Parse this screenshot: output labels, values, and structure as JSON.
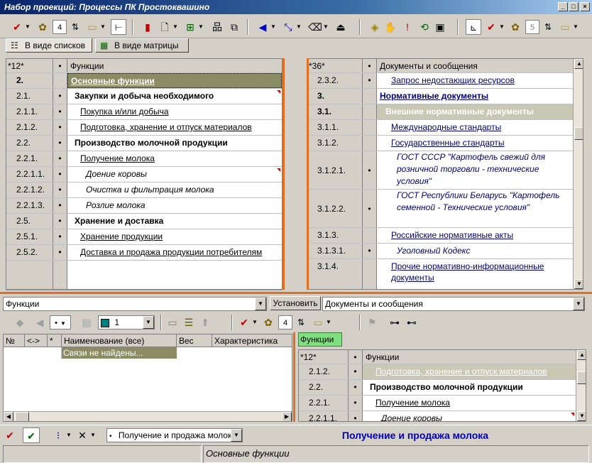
{
  "window": {
    "title": "Набор проекций: Процессы ПК Простоквашино"
  },
  "toolbar": {
    "spin1_value": "4",
    "spin2_value": "5"
  },
  "tabs": [
    {
      "label": "В виде списков"
    },
    {
      "label": "В виде матрицы"
    }
  ],
  "left_grid": {
    "header": {
      "code": "*12*",
      "dot": "•",
      "name": "Функции"
    },
    "rows": [
      {
        "code": "2.",
        "dot": "",
        "name": "Основные функции"
      },
      {
        "code": "2.1.",
        "dot": "•",
        "name": "Закупки и добыча необходимого"
      },
      {
        "code": "2.1.1.",
        "dot": "•",
        "name": "Покупка и/или добыча"
      },
      {
        "code": "2.1.2.",
        "dot": "•",
        "name": "Подготовка, хранение и отпуск материалов"
      },
      {
        "code": "2.2.",
        "dot": "•",
        "name": "Производство молочной продукции"
      },
      {
        "code": "2.2.1.",
        "dot": "•",
        "name": "Получение молока"
      },
      {
        "code": "2.2.1.1.",
        "dot": "•",
        "name": "Доение коровы"
      },
      {
        "code": "2.2.1.2.",
        "dot": "•",
        "name": "Очистка и фильтрация молока"
      },
      {
        "code": "2.2.1.3.",
        "dot": "•",
        "name": "Розлие молока"
      },
      {
        "code": "2.5.",
        "dot": "•",
        "name": "Хранение и доставка"
      },
      {
        "code": "2.5.1.",
        "dot": "•",
        "name": "Хранение продукции"
      },
      {
        "code": "2.5.2.",
        "dot": "•",
        "name": "Доставка и продажа продукции потребителям"
      }
    ]
  },
  "right_grid": {
    "header": {
      "code": "*36*",
      "dot": "•",
      "name": "Документы и сообщения"
    },
    "rows": [
      {
        "code": "2.3.2.",
        "dot": "•",
        "name": "Запрос недостающих ресурсов"
      },
      {
        "code": "3.",
        "dot": "",
        "name": "Нормативные документы"
      },
      {
        "code": "3.1.",
        "dot": "",
        "name": "Внешние нормативные документы"
      },
      {
        "code": "3.1.1.",
        "dot": "",
        "name": "Международные стандарты"
      },
      {
        "code": "3.1.2.",
        "dot": "",
        "name": "Государственные стандарты"
      },
      {
        "code": "3.1.2.1.",
        "dot": "•",
        "name": "ГОСТ СССР \"Картофель свежий для розничной торговли - технические условия\""
      },
      {
        "code": "3.1.2.2.",
        "dot": "•",
        "name": "ГОСТ Республики Беларусь \"Картофель семенной - Технические условия\""
      },
      {
        "code": "3.1.3.",
        "dot": "",
        "name": "Российские нормативные акты"
      },
      {
        "code": "3.1.3.1.",
        "dot": "•",
        "name": "Уголовный Кодекс"
      },
      {
        "code": "3.1.4.",
        "dot": "",
        "name": "Прочие нормативно-информационные документы"
      }
    ]
  },
  "middle": {
    "left_combo": "Функции",
    "set_button": "Установить",
    "right_combo": "Документы и сообщения"
  },
  "bottom_toolbar": {
    "color_value": "1",
    "spin_value": "4",
    "dot_value": "•"
  },
  "links_table": {
    "headers": [
      "№",
      "<->",
      "*",
      "Наименование (все)",
      "Вес",
      "Характеристика"
    ],
    "empty_text": "Связи не найдены..."
  },
  "bottom_right": {
    "tab": "Функции",
    "header": {
      "code": "*12*",
      "dot": "•",
      "name": "Функции"
    },
    "rows": [
      {
        "code": "2.1.2.",
        "dot": "•",
        "name": "Подготовка, хранение и отпуск материалов"
      },
      {
        "code": "2.2.",
        "dot": "•",
        "name": "Производство молочной продукции"
      },
      {
        "code": "2.2.1.",
        "dot": "•",
        "name": "Получение молока"
      },
      {
        "code": "2.2.1.1.",
        "dot": "•",
        "name": "Доение коровы"
      }
    ]
  },
  "bottom_bar": {
    "combo_value": "Получение и продажа молок:",
    "selected_title": "Получение и продажа молока"
  },
  "status": {
    "text": "Основные функции"
  }
}
